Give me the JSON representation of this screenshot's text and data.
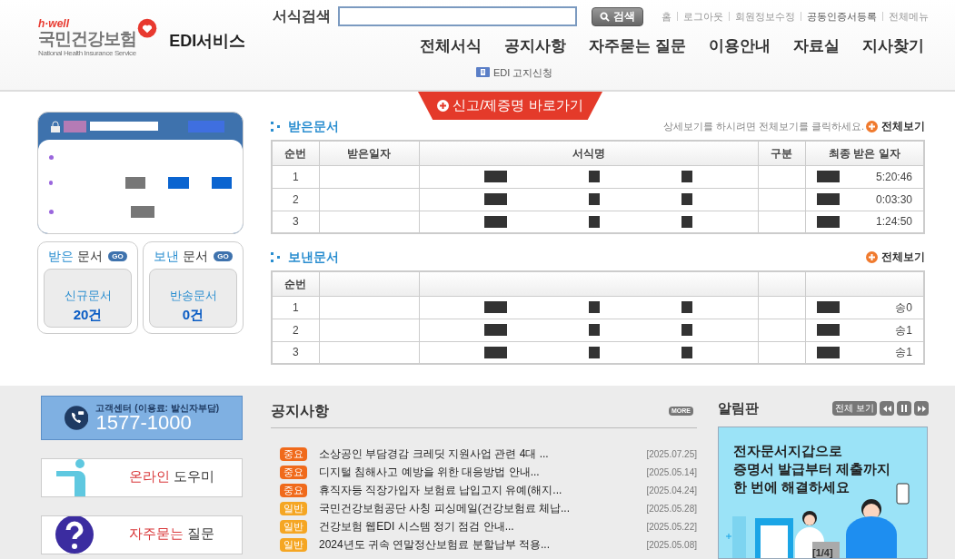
{
  "header": {
    "logo": {
      "tagline": "h·well",
      "name": "국민건강보험",
      "english": "National Health Insurance Service"
    },
    "service_title": "EDI서비스",
    "search": {
      "label": "서식검색",
      "button": "검색"
    },
    "top_links": [
      "홈",
      "로그아웃",
      "회원정보수정",
      "공동인증서등록",
      "전체메뉴"
    ],
    "nav": [
      "전체서식",
      "공지사항",
      "자주묻는 질문",
      "이용안내",
      "자료실",
      "지사찾기"
    ],
    "sub_link": "EDI 고지신청",
    "shortcut_tab": "신고/제증명 바로가기"
  },
  "doc_boxes": [
    {
      "title_accent": "받은",
      "title_rest": "문서",
      "go": "GO",
      "label": "신규문서",
      "count": "20건"
    },
    {
      "title_accent": "보낸",
      "title_rest": "문서",
      "go": "GO",
      "label": "반송문서",
      "count": "0건"
    }
  ],
  "received": {
    "title": "받은문서",
    "hint": "상세보기를 하시려면 전체보기를 클릭하세요.",
    "view_all": "전체보기",
    "columns": [
      "순번",
      "받은일자",
      "서식명",
      "구분",
      "최종 받은 일자"
    ],
    "rows": [
      {
        "no": "1",
        "last_date": "5:20:46"
      },
      {
        "no": "2",
        "last_date": "0:03:30"
      },
      {
        "no": "3",
        "last_date": "1:24:50"
      }
    ]
  },
  "sent": {
    "title": "보낸문서",
    "view_all": "전체보기",
    "columns": [
      "순번"
    ],
    "rows": [
      {
        "no": "1",
        "status": "송0"
      },
      {
        "no": "2",
        "status": "송1"
      },
      {
        "no": "3",
        "status": "송1"
      }
    ]
  },
  "customer_center": {
    "label": "고객센터 (이용료: 발신자부담)",
    "phone": "1577-1000"
  },
  "quick_links": [
    {
      "kind": "helper",
      "accent": "온라인",
      "rest": "도우미"
    },
    {
      "kind": "faq",
      "accent": "자주묻는",
      "rest": "질문"
    }
  ],
  "notices": {
    "title": "공지사항",
    "more": "MORE",
    "items": [
      {
        "kind": "important",
        "tag": "중요",
        "title": "소상공인 부담경감 크레딧 지원사업 관련 4대 ...",
        "date": "[2025.07.25]"
      },
      {
        "kind": "important",
        "tag": "중요",
        "title": "디지털 침해사고 예방을 위한 대응방법 안내...",
        "date": "[2025.05.14]"
      },
      {
        "kind": "important",
        "tag": "중요",
        "title": "휴직자등 직장가입자 보험료 납입고지 유예(해지...",
        "date": "[2025.04.24]"
      },
      {
        "kind": "general",
        "tag": "일반",
        "title": "국민건강보험공단 사칭 피싱메일(건강보험료 체납...",
        "date": "[2025.05.28]"
      },
      {
        "kind": "general",
        "tag": "일반",
        "title": "건강보험 웹EDI 시스템 정기 점검 안내...",
        "date": "[2025.05.22]"
      },
      {
        "kind": "general",
        "tag": "일반",
        "title": "2024년도 귀속 연말정산보험료 분할납부 적용...",
        "date": "[2025.05.08]"
      }
    ]
  },
  "board": {
    "title": "알림판",
    "view_all": "전체 보기",
    "banner": {
      "lines": [
        "전자문서지갑으로",
        "증명서 발급부터 제출까지",
        "한 번에 해결하세요"
      ],
      "counter": "[1/4]"
    }
  }
}
